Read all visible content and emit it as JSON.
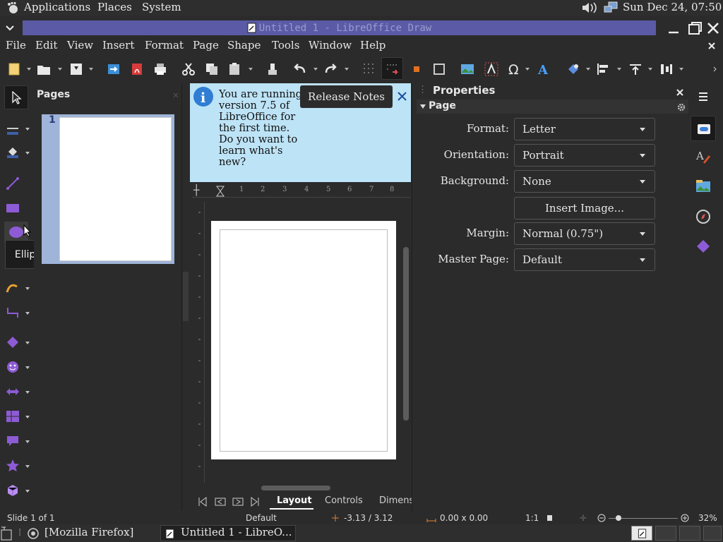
{
  "gnome_panel": {
    "applications": "Applications",
    "places": "Places",
    "system": "System",
    "clock": "Sun Dec 24, 07:50"
  },
  "window": {
    "title": "Untitled 1 - LibreOffice Draw"
  },
  "menubar": [
    "File",
    "Edit",
    "View",
    "Insert",
    "Format",
    "Page",
    "Shape",
    "Tools",
    "Window",
    "Help"
  ],
  "pages_pane": {
    "title": "Pages",
    "page_number": "1"
  },
  "infobar": {
    "text": "You are running version 7.5 of LibreOffice for the first time. Do you want to learn what's new?",
    "button": "Release Notes"
  },
  "ruler": {
    "h_ticks": [
      "1",
      "2",
      "3",
      "4",
      "5",
      "6",
      "7",
      "8"
    ]
  },
  "tabs": [
    "Layout",
    "Controls",
    "Dimens"
  ],
  "tooltip": "Ellipse",
  "properties": {
    "title": "Properties",
    "section": "Page",
    "format_label": "Format:",
    "format_value": "Letter",
    "orientation_label": "Orientation:",
    "orientation_value": "Portrait",
    "background_label": "Background:",
    "background_value": "None",
    "insert_image": "Insert Image...",
    "margin_label": "Margin:",
    "margin_value": "Normal (0.75\")",
    "master_label": "Master Page:",
    "master_value": "Default"
  },
  "statusbar": {
    "slide": "Slide 1 of 1",
    "layout": "Default",
    "position": "-3.13 / 3.12",
    "size": "0.00 x 0.00",
    "scale": "1:1",
    "zoom": "32%"
  },
  "taskbar": {
    "firefox": "[Mozilla Firefox]",
    "libreoffice": "Untitled 1 - LibreO..."
  },
  "colors": {
    "accent": "#5a5aa6",
    "infobar": "#bde3f6",
    "shape": "#8e5bd6"
  }
}
